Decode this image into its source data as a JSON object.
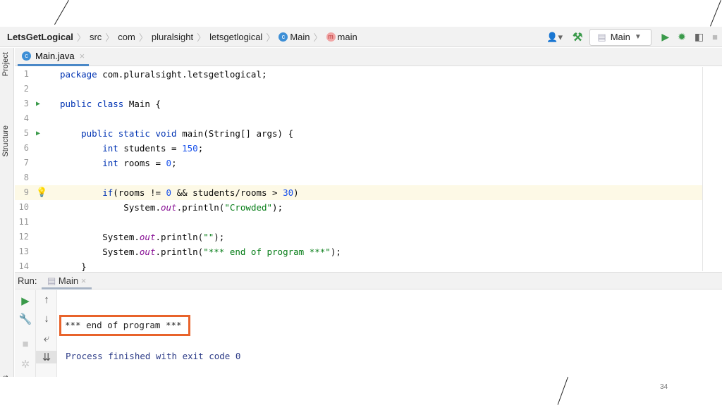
{
  "breadcrumb": [
    "LetsGetLogical",
    "src",
    "com",
    "pluralsight",
    "letsgetlogical",
    "Main",
    "main"
  ],
  "run_config": "Main",
  "left_panels": {
    "project": "Project",
    "structure": "Structure",
    "bookmarks": "marks"
  },
  "editor_tab": "Main.java",
  "code_lines": [
    {
      "n": "1",
      "t": [
        [
          "package ",
          "kw"
        ],
        [
          "com.pluralsight.letsgetlogical;",
          ""
        ]
      ]
    },
    {
      "n": "2",
      "t": []
    },
    {
      "n": "3",
      "run": true,
      "t": [
        [
          "public class ",
          "kw"
        ],
        [
          "Main {",
          ""
        ]
      ]
    },
    {
      "n": "4",
      "t": []
    },
    {
      "n": "5",
      "run": true,
      "t": [
        [
          "    public static void ",
          "kw"
        ],
        [
          "main(String[] args) {",
          ""
        ]
      ]
    },
    {
      "n": "6",
      "t": [
        [
          "        int ",
          "kw"
        ],
        [
          "students = ",
          ""
        ],
        [
          "150",
          "num"
        ],
        [
          ";",
          ""
        ]
      ]
    },
    {
      "n": "7",
      "t": [
        [
          "        int ",
          "kw"
        ],
        [
          "rooms = ",
          ""
        ],
        [
          "0",
          "num"
        ],
        [
          ";",
          ""
        ]
      ]
    },
    {
      "n": "8",
      "t": []
    },
    {
      "n": "9",
      "bulb": true,
      "t": [
        [
          "        if",
          "kw"
        ],
        [
          "(rooms != ",
          ""
        ],
        [
          "0",
          "num"
        ],
        [
          " && students/rooms > ",
          ""
        ],
        [
          "30",
          "num"
        ],
        [
          ")",
          ""
        ]
      ]
    },
    {
      "n": "10",
      "t": [
        [
          "            System.",
          ""
        ],
        [
          "out",
          "it"
        ],
        [
          ".println(",
          ""
        ],
        [
          "\"Crowded\"",
          "str"
        ],
        [
          ");",
          ""
        ]
      ]
    },
    {
      "n": "11",
      "t": []
    },
    {
      "n": "12",
      "t": [
        [
          "        System.",
          ""
        ],
        [
          "out",
          "it"
        ],
        [
          ".println(",
          ""
        ],
        [
          "\"\"",
          "str"
        ],
        [
          ");",
          ""
        ]
      ]
    },
    {
      "n": "13",
      "t": [
        [
          "        System.",
          ""
        ],
        [
          "out",
          "it"
        ],
        [
          ".println(",
          ""
        ],
        [
          "\"*** end of program ***\"",
          "str"
        ],
        [
          ");",
          ""
        ]
      ]
    },
    {
      "n": "14",
      "t": [
        [
          "    }",
          ""
        ]
      ]
    }
  ],
  "run": {
    "label": "Run:",
    "tab": "Main"
  },
  "console": {
    "output": "*** end of program ***",
    "exit": "Process finished with exit code 0",
    "highlight_color": "#e8632b"
  },
  "slide_number": "34"
}
